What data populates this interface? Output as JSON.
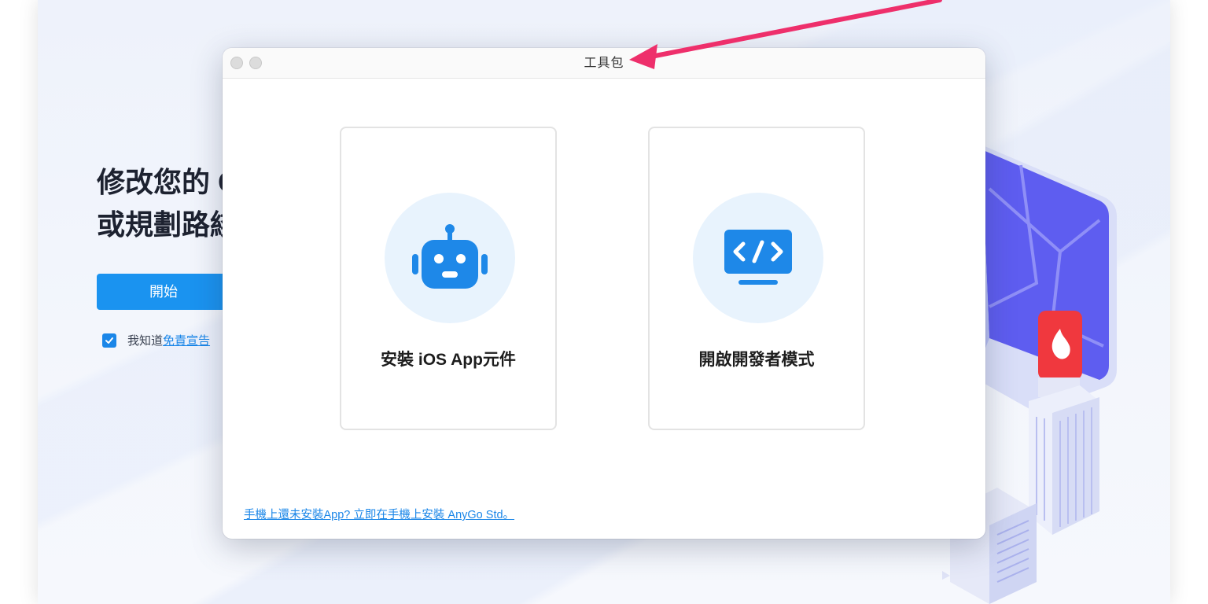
{
  "background_app": {
    "hero_line1": "修改您的 G",
    "hero_line2": "或規劃路綫",
    "start_label": "開始",
    "agree_text": "我知道",
    "disclaimer_link": "免責宣告"
  },
  "dialog": {
    "title": "工具包",
    "cards": [
      {
        "label": "安裝 iOS App元件",
        "icon": "robot-icon"
      },
      {
        "label": "開啟開發者模式",
        "icon": "code-monitor-icon"
      }
    ],
    "footer_link": "手機上還未安裝App? 立即在手機上安裝 AnyGo Std。"
  },
  "colors": {
    "accent": "#1a93f0",
    "icon_blue": "#1e88e8",
    "annotation_arrow": "#ee2f6b",
    "badge_red": "#f0383e"
  }
}
